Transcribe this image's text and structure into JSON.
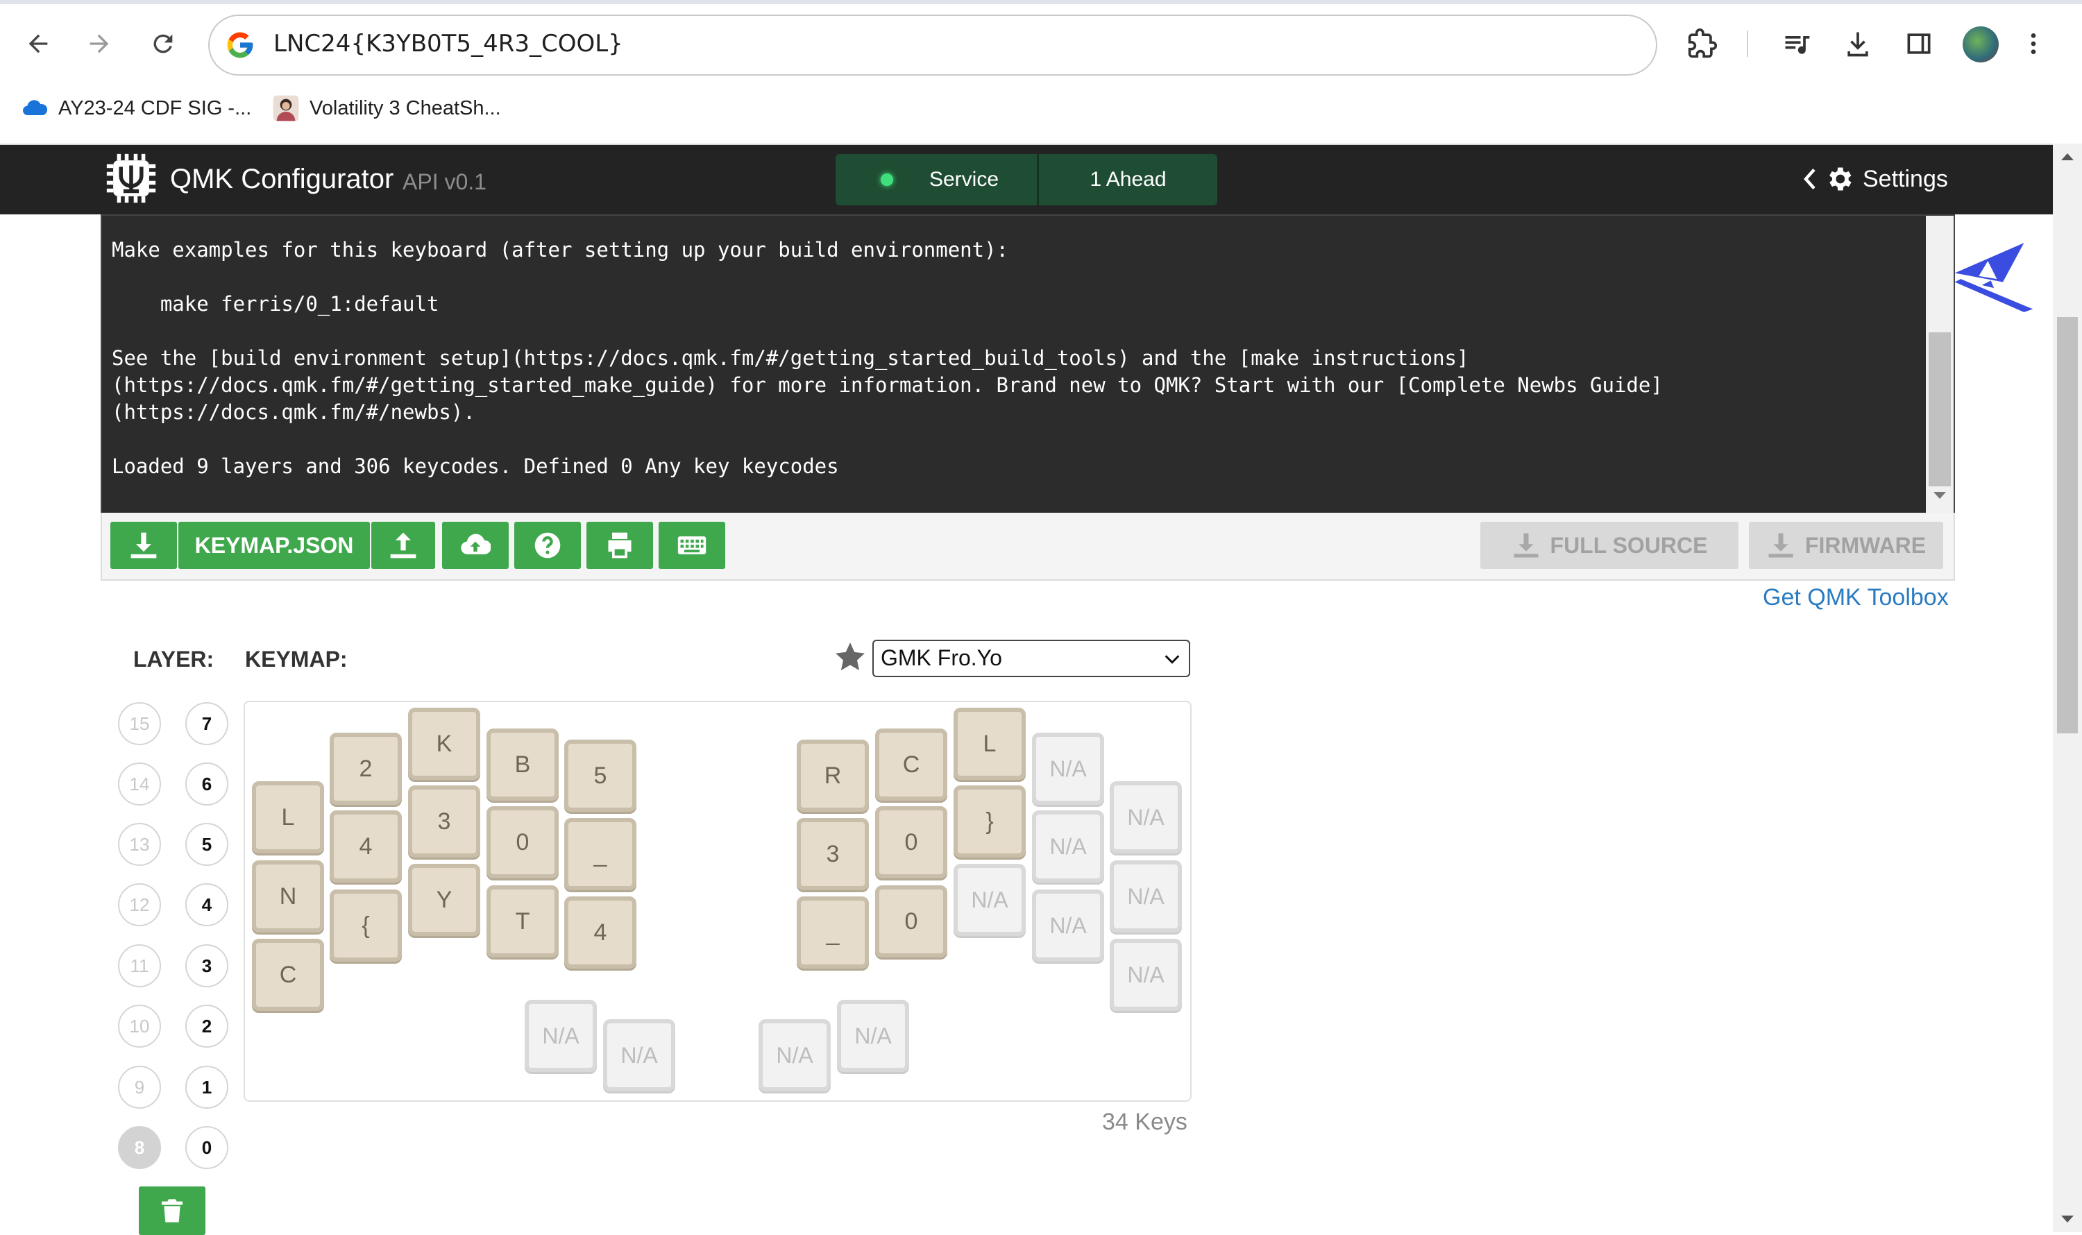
{
  "browser": {
    "url": "LNC24{K3YB0T5_4R3_COOL}",
    "bookmarks": [
      "AY23-24 CDF SIG -...",
      "Volatility 3 CheatSh..."
    ]
  },
  "header": {
    "title": "QMK Configurator",
    "api": "API v0.1",
    "status_service": "Service",
    "status_ahead": "1 Ahead",
    "settings": "Settings"
  },
  "console": {
    "lines": [
      "Make examples for this keyboard (after setting up your build environment):",
      "",
      "    make ferris/0_1:default",
      "",
      "See the [build environment setup](https://docs.qmk.fm/#/getting_started_build_tools) and the [make instructions]",
      "(https://docs.qmk.fm/#/getting_started_make_guide) for more information. Brand new to QMK? Start with our [Complete Newbs Guide]",
      "(https://docs.qmk.fm/#/newbs).",
      "",
      "Loaded 9 layers and 306 keycodes. Defined 0 Any key keycodes"
    ]
  },
  "toolbar": {
    "keymap_json": "KEYMAP.JSON",
    "full_source": "FULL SOURCE",
    "firmware": "FIRMWARE",
    "toolbox_link": "Get QMK Toolbox"
  },
  "keymap": {
    "layer_label": "LAYER:",
    "keymap_label": "KEYMAP:",
    "theme": "GMK Fro.Yo",
    "layers_left": [
      "15",
      "14",
      "13",
      "12",
      "11",
      "10",
      "9",
      "8"
    ],
    "layers_right": [
      "7",
      "6",
      "5",
      "4",
      "3",
      "2",
      "1",
      "0"
    ],
    "selected_layer": "8",
    "key_count": "34 Keys",
    "keys": [
      "L",
      "N",
      "C",
      "2",
      "4",
      "{",
      "K",
      "3",
      "Y",
      "B",
      "0",
      "T",
      "5",
      "_",
      "4",
      "N/A",
      "N/A",
      "R",
      "3",
      "_",
      "C",
      "0",
      "0",
      "L",
      "}",
      "N/A",
      "N/A",
      "N/A",
      "N/A",
      "N/A",
      "N/A",
      "N/A",
      "N/A",
      "N/A"
    ]
  },
  "colors": {
    "header_bg": "#232323",
    "button_green": "#3fa84c",
    "status_green": "#1f4d33",
    "key_beige": "#e5dccb",
    "link_blue": "#2a7bbf"
  }
}
